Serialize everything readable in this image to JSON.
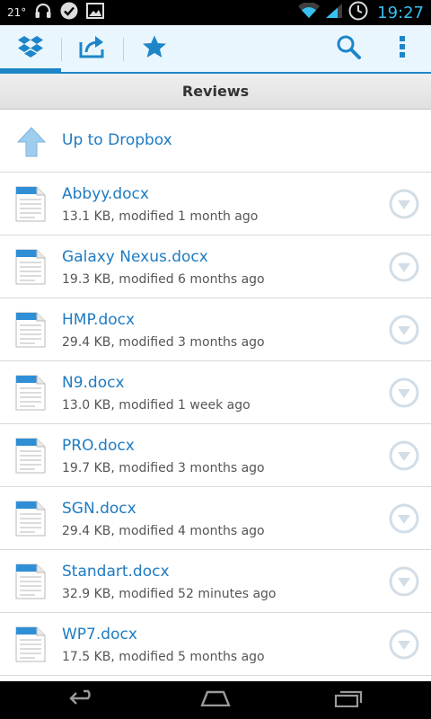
{
  "status_bar": {
    "temperature": "21°",
    "time": "19:27",
    "icons": [
      "headphones-icon",
      "check-circle-icon",
      "image-icon",
      "wifi-icon",
      "signal-icon",
      "alarm-clock-icon"
    ]
  },
  "action_bar": {
    "tabs": [
      {
        "icon": "dropbox-icon",
        "active": true
      },
      {
        "icon": "upload-icon",
        "active": false
      },
      {
        "icon": "star-icon",
        "active": false
      }
    ],
    "actions": [
      "search-icon",
      "overflow-menu-icon"
    ]
  },
  "folder": {
    "title": "Reviews",
    "up_label": "Up to Dropbox"
  },
  "files": [
    {
      "name": "Abbyy.docx",
      "meta": "13.1 KB, modified 1 month ago"
    },
    {
      "name": "Galaxy Nexus.docx",
      "meta": "19.3 KB, modified 6 months ago"
    },
    {
      "name": "HMP.docx",
      "meta": "29.4 KB, modified 3 months ago"
    },
    {
      "name": "N9.docx",
      "meta": "13.0 KB, modified 1 week ago"
    },
    {
      "name": "PRO.docx",
      "meta": "19.7 KB, modified 3 months ago"
    },
    {
      "name": "SGN.docx",
      "meta": "29.4 KB, modified 4 months ago"
    },
    {
      "name": "Standart.docx",
      "meta": "32.9 KB, modified 52 minutes ago"
    },
    {
      "name": "WP7.docx",
      "meta": "17.5 KB, modified 5 months ago"
    }
  ],
  "nav_bar": {
    "buttons": [
      "back-icon",
      "home-icon",
      "recent-apps-icon"
    ]
  },
  "colors": {
    "accent": "#1e86c8",
    "link": "#1e7bc2",
    "action_bar_bg": "#e9f6fd",
    "clock": "#38c0ef"
  }
}
